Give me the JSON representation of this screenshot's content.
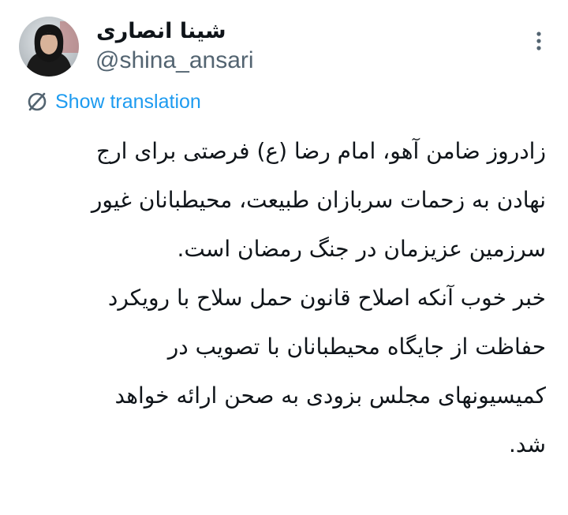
{
  "author": {
    "display_name": "شینا انصاری",
    "handle": "@shina_ansari"
  },
  "actions": {
    "more_icon": "more-vertical-icon",
    "translate_icon": "translate-globe-icon",
    "translate_label": "Show translation"
  },
  "tweet": {
    "lines": [
      "زادروز ضامن آهو، امام رضا (ع) فرصتی برای ارج",
      "نهادن به زحمات سربازان طبیعت، محیطبانان غیور",
      "سرزمین عزیزمان در جنگ رمضان است.",
      "خبر خوب آنکه اصلاح قانون حمل سلاح با رویکرد",
      "حفاظت از جایگاه محیطبانان با تصویب در",
      "کمیسیونهای مجلس بزودی به صحن ارائه خواهد",
      "شد."
    ]
  },
  "colors": {
    "text": "#0f1419",
    "secondary": "#536471",
    "link": "#1d9bf0"
  }
}
